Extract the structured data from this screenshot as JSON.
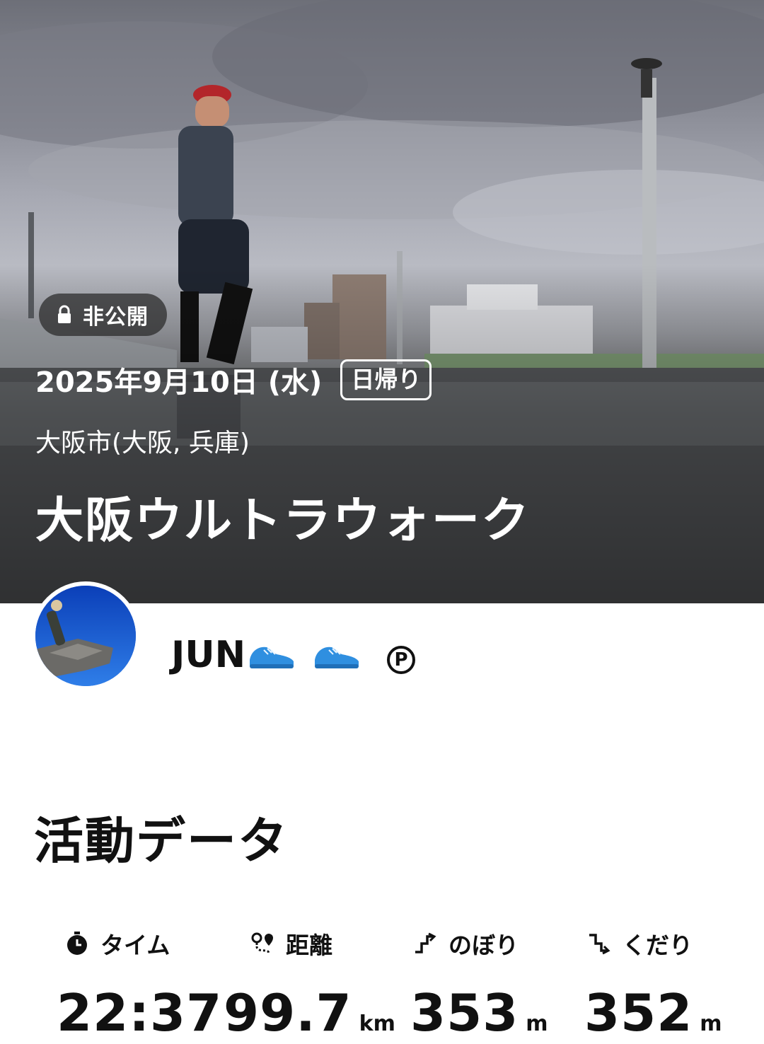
{
  "hero": {
    "privacy_label": "非公開",
    "date": "2025年9月10日 (水)",
    "type_tag": "日帰り",
    "area": "大阪市(大阪, 兵庫)",
    "title": "大阪ウルトラウォーク"
  },
  "user": {
    "name": "JUN"
  },
  "activity": {
    "section_title": "活動データ",
    "stats": [
      {
        "label": "タイム",
        "value": "22:37",
        "unit": ""
      },
      {
        "label": "距離",
        "value": "99.7",
        "unit": "km"
      },
      {
        "label": "のぼり",
        "value": "353",
        "unit": "m"
      },
      {
        "label": "くだり",
        "value": "352",
        "unit": "m"
      }
    ]
  },
  "icons": {
    "privacy": "lock-icon",
    "time": "stopwatch-icon",
    "distance": "route-pin-icon",
    "up": "ascent-icon",
    "down": "descent-icon",
    "premium": "premium-p-icon",
    "shoe": "running-shoe-icon"
  },
  "colors": {
    "shoe": "#2f8fe0",
    "text": "#111111",
    "badge_bg": "#282828"
  }
}
